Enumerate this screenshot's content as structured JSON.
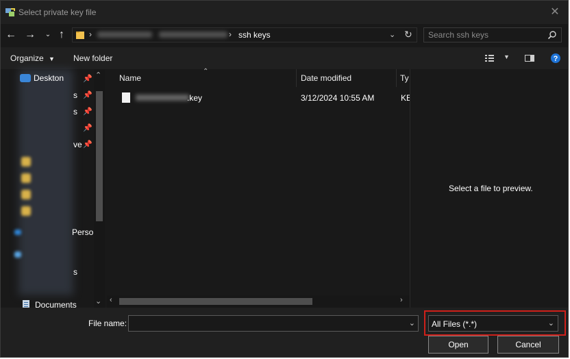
{
  "window": {
    "title": "Select private key file"
  },
  "address": {
    "current_folder": "ssh keys"
  },
  "search": {
    "placeholder": "Search ssh keys"
  },
  "toolbar": {
    "organize_label": "Organize",
    "new_folder_label": "New folder"
  },
  "nav_pane": {
    "top_partial_label": "Deskton",
    "items_partial": [
      "s",
      "s",
      "ve",
      "Persor",
      "s"
    ],
    "documents_label": "Documents"
  },
  "columns": {
    "name": "Name",
    "date_modified": "Date modified",
    "type": "Ty"
  },
  "files": [
    {
      "name_suffix": ".key",
      "date_modified": "3/12/2024 10:55 AM",
      "type": "KE"
    }
  ],
  "preview": {
    "message": "Select a file to preview."
  },
  "footer": {
    "file_name_label": "File name:",
    "file_name_value": "",
    "filter_selected": "All Files (*.*)",
    "open_label": "Open",
    "cancel_label": "Cancel"
  },
  "colors": {
    "highlight": "#d0201a",
    "help_blue": "#1e73d6",
    "folder_yellow": "#f2c14e"
  }
}
